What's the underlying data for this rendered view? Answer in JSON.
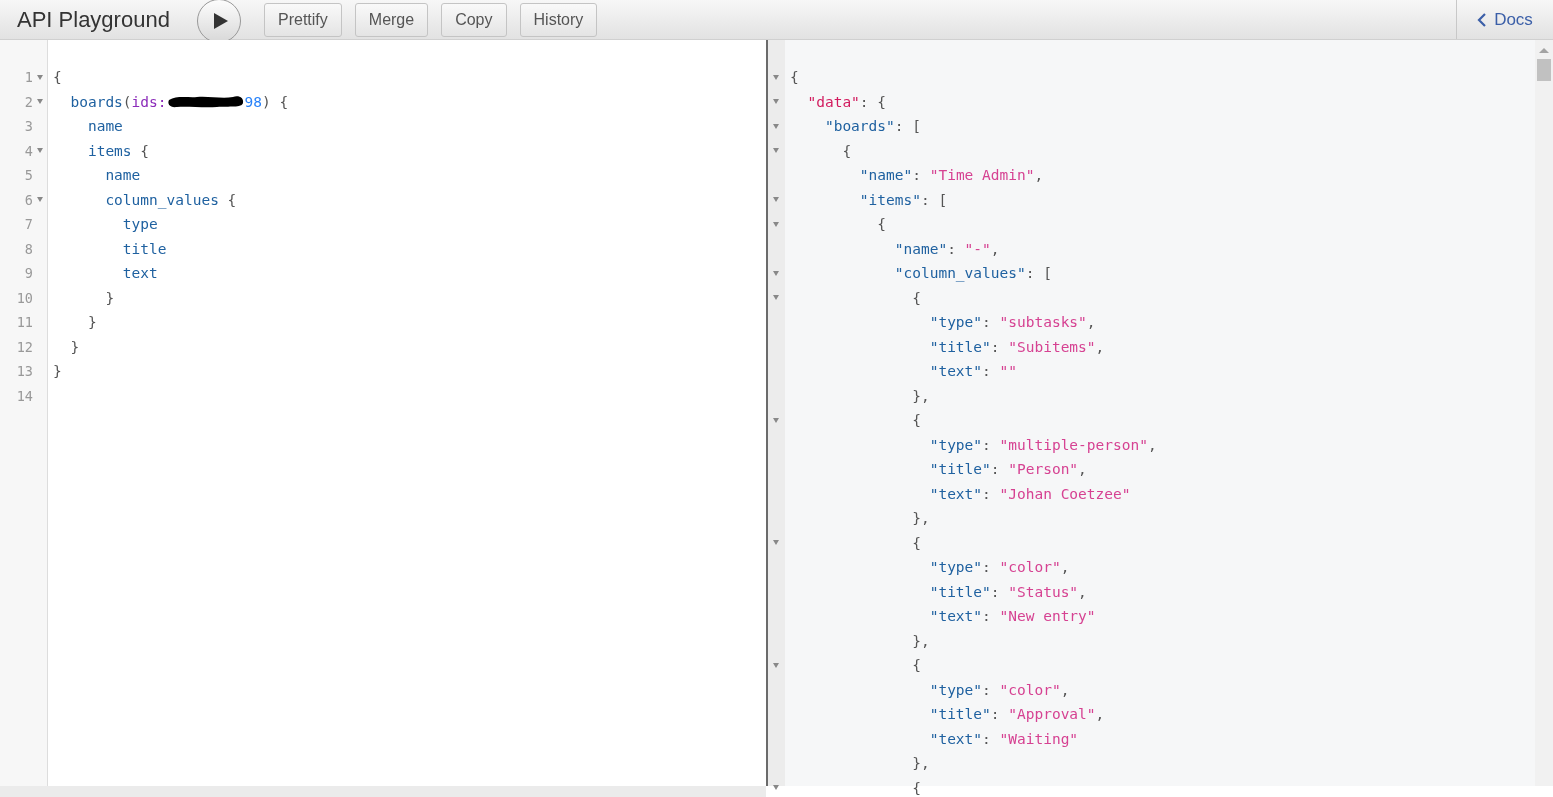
{
  "toolbar": {
    "title": "API Playground",
    "buttons": [
      "Prettify",
      "Merge",
      "Copy",
      "History"
    ],
    "docs_link": "Docs"
  },
  "query_editor": {
    "lines": [
      {
        "number": "1",
        "foldable": true,
        "tokens": [
          {
            "kind": "punct",
            "text": "{"
          }
        ]
      },
      {
        "number": "2",
        "foldable": true,
        "tokens": [
          {
            "kind": "field",
            "text": "  boards"
          },
          {
            "kind": "punct",
            "text": "("
          },
          {
            "kind": "arg",
            "text": "ids:"
          },
          {
            "kind": "redaction"
          },
          {
            "kind": "number",
            "text": "98"
          },
          {
            "kind": "punct",
            "text": ") {"
          }
        ]
      },
      {
        "number": "3",
        "foldable": false,
        "tokens": [
          {
            "kind": "field",
            "text": "    name"
          }
        ]
      },
      {
        "number": "4",
        "foldable": true,
        "tokens": [
          {
            "kind": "field",
            "text": "    items"
          },
          {
            "kind": "punct",
            "text": " {"
          }
        ]
      },
      {
        "number": "5",
        "foldable": false,
        "tokens": [
          {
            "kind": "field",
            "text": "      name"
          }
        ]
      },
      {
        "number": "6",
        "foldable": true,
        "tokens": [
          {
            "kind": "field",
            "text": "      column_values"
          },
          {
            "kind": "punct",
            "text": " {"
          }
        ]
      },
      {
        "number": "7",
        "foldable": false,
        "tokens": [
          {
            "kind": "field",
            "text": "        type"
          }
        ]
      },
      {
        "number": "8",
        "foldable": false,
        "tokens": [
          {
            "kind": "field",
            "text": "        title"
          }
        ]
      },
      {
        "number": "9",
        "foldable": false,
        "tokens": [
          {
            "kind": "field",
            "text": "        text"
          }
        ]
      },
      {
        "number": "10",
        "foldable": false,
        "tokens": [
          {
            "kind": "punct",
            "text": "      }"
          }
        ]
      },
      {
        "number": "11",
        "foldable": false,
        "tokens": [
          {
            "kind": "punct",
            "text": "    }"
          }
        ]
      },
      {
        "number": "12",
        "foldable": false,
        "tokens": [
          {
            "kind": "punct",
            "text": "  }"
          }
        ]
      },
      {
        "number": "13",
        "foldable": false,
        "tokens": [
          {
            "kind": "punct",
            "text": "}"
          }
        ]
      },
      {
        "number": "14",
        "foldable": false
      }
    ]
  },
  "result_viewer": {
    "lines": [
      {
        "foldable": true,
        "tokens": [
          {
            "kind": "punct",
            "text": "{"
          }
        ]
      },
      {
        "foldable": true,
        "tokens": [
          {
            "kind": "datakey",
            "text": "  \"data\""
          },
          {
            "kind": "punct",
            "text": ": {"
          }
        ]
      },
      {
        "foldable": true,
        "tokens": [
          {
            "kind": "key",
            "text": "    \"boards\""
          },
          {
            "kind": "punct",
            "text": ": ["
          }
        ]
      },
      {
        "foldable": true,
        "tokens": [
          {
            "kind": "punct",
            "text": "      {"
          }
        ]
      },
      {
        "foldable": false,
        "tokens": [
          {
            "kind": "key",
            "text": "        \"name\""
          },
          {
            "kind": "punct",
            "text": ": "
          },
          {
            "kind": "string",
            "text": "\"Time Admin\""
          },
          {
            "kind": "punct",
            "text": ","
          }
        ]
      },
      {
        "foldable": true,
        "tokens": [
          {
            "kind": "key",
            "text": "        \"items\""
          },
          {
            "kind": "punct",
            "text": ": ["
          }
        ]
      },
      {
        "foldable": true,
        "tokens": [
          {
            "kind": "punct",
            "text": "          {"
          }
        ]
      },
      {
        "foldable": false,
        "tokens": [
          {
            "kind": "key",
            "text": "            \"name\""
          },
          {
            "kind": "punct",
            "text": ": "
          },
          {
            "kind": "string",
            "text": "\"-\""
          },
          {
            "kind": "punct",
            "text": ","
          }
        ]
      },
      {
        "foldable": true,
        "tokens": [
          {
            "kind": "key",
            "text": "            \"column_values\""
          },
          {
            "kind": "punct",
            "text": ": ["
          }
        ]
      },
      {
        "foldable": true,
        "tokens": [
          {
            "kind": "punct",
            "text": "              {"
          }
        ]
      },
      {
        "foldable": false,
        "tokens": [
          {
            "kind": "key",
            "text": "                \"type\""
          },
          {
            "kind": "punct",
            "text": ": "
          },
          {
            "kind": "string",
            "text": "\"subtasks\""
          },
          {
            "kind": "punct",
            "text": ","
          }
        ]
      },
      {
        "foldable": false,
        "tokens": [
          {
            "kind": "key",
            "text": "                \"title\""
          },
          {
            "kind": "punct",
            "text": ": "
          },
          {
            "kind": "string",
            "text": "\"Subitems\""
          },
          {
            "kind": "punct",
            "text": ","
          }
        ]
      },
      {
        "foldable": false,
        "tokens": [
          {
            "kind": "key",
            "text": "                \"text\""
          },
          {
            "kind": "punct",
            "text": ": "
          },
          {
            "kind": "string",
            "text": "\"\""
          }
        ]
      },
      {
        "foldable": false,
        "tokens": [
          {
            "kind": "punct",
            "text": "              },"
          }
        ]
      },
      {
        "foldable": true,
        "tokens": [
          {
            "kind": "punct",
            "text": "              {"
          }
        ]
      },
      {
        "foldable": false,
        "tokens": [
          {
            "kind": "key",
            "text": "                \"type\""
          },
          {
            "kind": "punct",
            "text": ": "
          },
          {
            "kind": "string",
            "text": "\"multiple-person\""
          },
          {
            "kind": "punct",
            "text": ","
          }
        ]
      },
      {
        "foldable": false,
        "tokens": [
          {
            "kind": "key",
            "text": "                \"title\""
          },
          {
            "kind": "punct",
            "text": ": "
          },
          {
            "kind": "string",
            "text": "\"Person\""
          },
          {
            "kind": "punct",
            "text": ","
          }
        ]
      },
      {
        "foldable": false,
        "tokens": [
          {
            "kind": "key",
            "text": "                \"text\""
          },
          {
            "kind": "punct",
            "text": ": "
          },
          {
            "kind": "string",
            "text": "\"Johan Coetzee\""
          }
        ]
      },
      {
        "foldable": false,
        "tokens": [
          {
            "kind": "punct",
            "text": "              },"
          }
        ]
      },
      {
        "foldable": true,
        "tokens": [
          {
            "kind": "punct",
            "text": "              {"
          }
        ]
      },
      {
        "foldable": false,
        "tokens": [
          {
            "kind": "key",
            "text": "                \"type\""
          },
          {
            "kind": "punct",
            "text": ": "
          },
          {
            "kind": "string",
            "text": "\"color\""
          },
          {
            "kind": "punct",
            "text": ","
          }
        ]
      },
      {
        "foldable": false,
        "tokens": [
          {
            "kind": "key",
            "text": "                \"title\""
          },
          {
            "kind": "punct",
            "text": ": "
          },
          {
            "kind": "string",
            "text": "\"Status\""
          },
          {
            "kind": "punct",
            "text": ","
          }
        ]
      },
      {
        "foldable": false,
        "tokens": [
          {
            "kind": "key",
            "text": "                \"text\""
          },
          {
            "kind": "punct",
            "text": ": "
          },
          {
            "kind": "string",
            "text": "\"New entry\""
          }
        ]
      },
      {
        "foldable": false,
        "tokens": [
          {
            "kind": "punct",
            "text": "              },"
          }
        ]
      },
      {
        "foldable": true,
        "tokens": [
          {
            "kind": "punct",
            "text": "              {"
          }
        ]
      },
      {
        "foldable": false,
        "tokens": [
          {
            "kind": "key",
            "text": "                \"type\""
          },
          {
            "kind": "punct",
            "text": ": "
          },
          {
            "kind": "string",
            "text": "\"color\""
          },
          {
            "kind": "punct",
            "text": ","
          }
        ]
      },
      {
        "foldable": false,
        "tokens": [
          {
            "kind": "key",
            "text": "                \"title\""
          },
          {
            "kind": "punct",
            "text": ": "
          },
          {
            "kind": "string",
            "text": "\"Approval\""
          },
          {
            "kind": "punct",
            "text": ","
          }
        ]
      },
      {
        "foldable": false,
        "tokens": [
          {
            "kind": "key",
            "text": "                \"text\""
          },
          {
            "kind": "punct",
            "text": ": "
          },
          {
            "kind": "string",
            "text": "\"Waiting\""
          }
        ]
      },
      {
        "foldable": false,
        "tokens": [
          {
            "kind": "punct",
            "text": "              },"
          }
        ]
      },
      {
        "foldable": true,
        "tokens": [
          {
            "kind": "punct",
            "text": "              {"
          }
        ]
      }
    ]
  }
}
